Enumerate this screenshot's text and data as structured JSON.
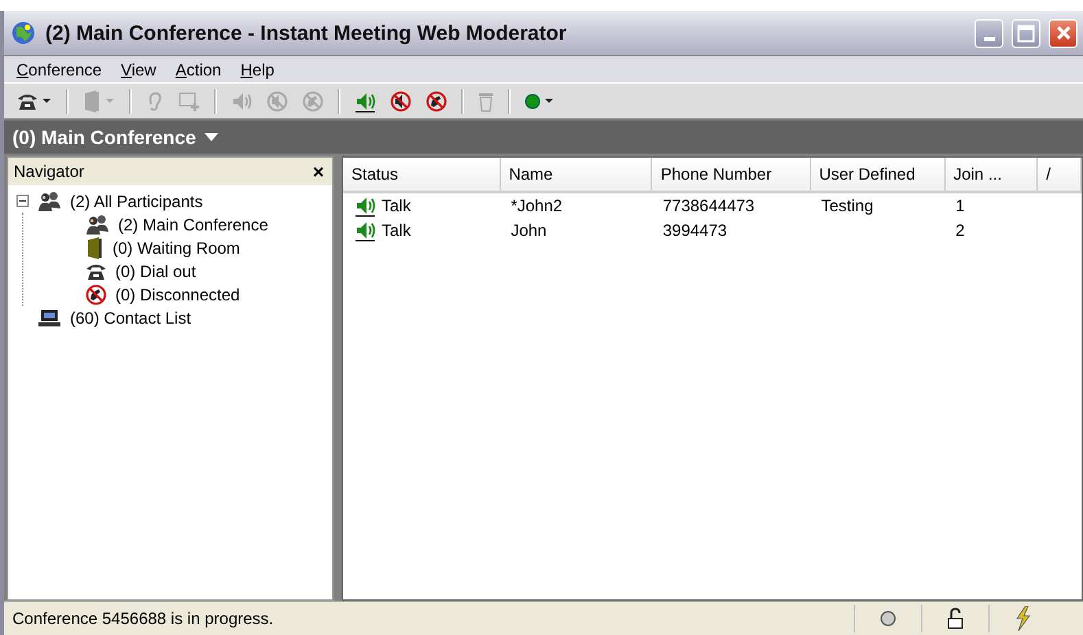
{
  "window": {
    "title": "(2) Main Conference - Instant Meeting Web Moderator"
  },
  "menu": [
    {
      "label": "Conference"
    },
    {
      "label": "View"
    },
    {
      "label": "Action"
    },
    {
      "label": "Help"
    }
  ],
  "toolbar": [
    {
      "kind": "phone",
      "disabled": false,
      "dropdown": true
    },
    {
      "kind": "separator"
    },
    {
      "kind": "door",
      "disabled": true,
      "dropdown": true
    },
    {
      "kind": "separator"
    },
    {
      "kind": "ear",
      "disabled": true,
      "dropdown": false
    },
    {
      "kind": "addwin",
      "disabled": true,
      "dropdown": false
    },
    {
      "kind": "separator"
    },
    {
      "kind": "speaker",
      "disabled": true,
      "dropdown": false
    },
    {
      "kind": "mute",
      "disabled": true,
      "dropdown": false
    },
    {
      "kind": "hangup",
      "disabled": true,
      "dropdown": false
    },
    {
      "kind": "separator"
    },
    {
      "kind": "speaker",
      "disabled": false,
      "dropdown": false
    },
    {
      "kind": "mute",
      "disabled": false,
      "dropdown": false
    },
    {
      "kind": "hangup",
      "disabled": false,
      "dropdown": false
    },
    {
      "kind": "separator"
    },
    {
      "kind": "trash",
      "disabled": true,
      "dropdown": false
    },
    {
      "kind": "separator"
    },
    {
      "kind": "dot",
      "disabled": false,
      "dropdown": true
    }
  ],
  "conference_selector": {
    "label": "(0) Main Conference"
  },
  "navigator": {
    "title": "Navigator",
    "close": "×",
    "tree": [
      {
        "label": "(2) All Participants",
        "kind": "people",
        "expanded": true,
        "children": [
          {
            "label": "(2) Main Conference",
            "kind": "people"
          },
          {
            "label": "(0) Waiting Room",
            "kind": "door"
          },
          {
            "label": "(0) Dial out",
            "kind": "phone"
          },
          {
            "label": "(0) Disconnected",
            "kind": "hangup"
          }
        ]
      },
      {
        "label": "(60) Contact List",
        "kind": "computer"
      }
    ]
  },
  "table": {
    "columns": [
      {
        "label": "Status"
      },
      {
        "label": "Name"
      },
      {
        "label": "Phone Number"
      },
      {
        "label": "User Defined"
      },
      {
        "label": "Join ..."
      },
      {
        "label": "/"
      }
    ],
    "rows": [
      {
        "status": "Talk",
        "name": "*John2",
        "phone": "7738644473",
        "user_defined": "Testing",
        "join": "1"
      },
      {
        "status": "Talk",
        "name": "John",
        "phone": "3994473",
        "join": "2"
      }
    ]
  },
  "status_bar": {
    "message": "Conference 5456688 is in progress."
  }
}
